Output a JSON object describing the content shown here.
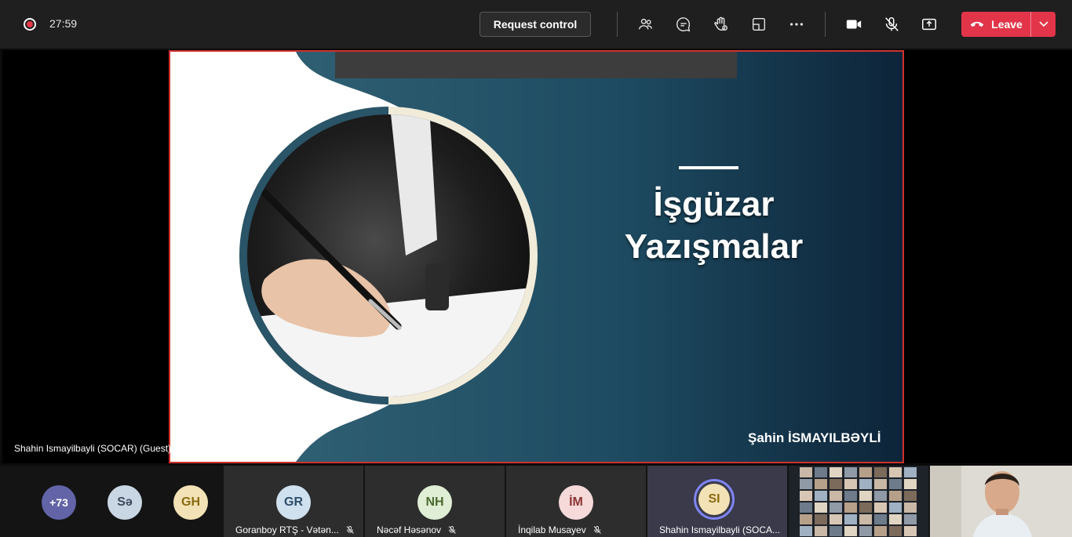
{
  "meeting": {
    "timer": "27:59",
    "request_control_label": "Request control",
    "leave_label": "Leave",
    "toolbar_icons": [
      "people-icon",
      "chat-icon",
      "raise-hand-icon",
      "rooms-icon",
      "more-icon",
      "camera-icon",
      "mic-off-icon",
      "share-icon"
    ]
  },
  "stage": {
    "presenter_name": "Shahin Ismayilbayli (SOCAR) (Guest)"
  },
  "slide": {
    "title_line1": "İşgüzar",
    "title_line2": "Yazışmalar",
    "author": "Şahin İSMAYILBƏYLİ"
  },
  "participants": {
    "overflow": {
      "initials": "+73",
      "color": "#6264a7"
    },
    "avatars": [
      {
        "initials": "Sə",
        "color": "#c9d6e3",
        "text": "#3a4a5e"
      },
      {
        "initials": "GH",
        "color": "#f3e2b5",
        "text": "#8a6a12"
      }
    ],
    "tiles": [
      {
        "initials": "GR",
        "name": "Goranboy RTŞ - Vətən...",
        "color": "#cfe0ee",
        "text": "#2d4d6b"
      },
      {
        "initials": "NH",
        "name": "Nəcəf Həsənov",
        "color": "#dfeed4",
        "text": "#4b6b32"
      },
      {
        "initials": "İM",
        "name": "İnqilab Musayev",
        "color": "#f6d9d9",
        "text": "#8a3434"
      },
      {
        "initials": "SI",
        "name": "Shahin Ismayilbayli (SOCA...",
        "color": "#f3e2b5",
        "text": "#8a6a12"
      }
    ]
  }
}
